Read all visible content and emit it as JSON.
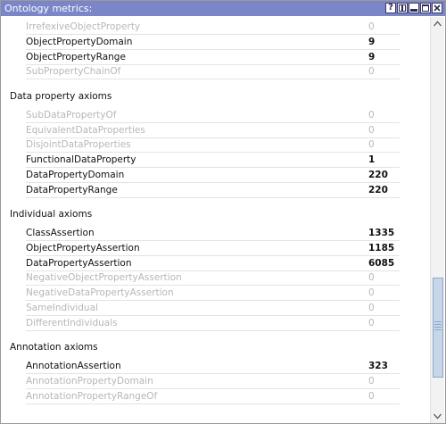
{
  "window": {
    "title": "Ontology metrics:"
  },
  "titlebar_buttons": [
    {
      "name": "help-button",
      "icon": "help-icon",
      "text": "?"
    },
    {
      "name": "split-button",
      "icon": "split-icon",
      "text": ""
    },
    {
      "name": "minimize-button",
      "icon": "minimize-icon",
      "text": ""
    },
    {
      "name": "maximize-button",
      "icon": "maximize-icon",
      "text": ""
    },
    {
      "name": "close-button",
      "icon": "close-icon",
      "text": ""
    }
  ],
  "sections": [
    {
      "title": "",
      "rows": [
        {
          "label": "IrrefexiveObjectProperty",
          "value": "0",
          "enabled": false
        },
        {
          "label": "ObjectPropertyDomain",
          "value": "9",
          "enabled": true
        },
        {
          "label": "ObjectPropertyRange",
          "value": "9",
          "enabled": true
        },
        {
          "label": "SubPropertyChainOf",
          "value": "0",
          "enabled": false
        }
      ]
    },
    {
      "title": "Data property axioms",
      "rows": [
        {
          "label": "SubDataPropertyOf",
          "value": "0",
          "enabled": false
        },
        {
          "label": "EquivalentDataProperties",
          "value": "0",
          "enabled": false
        },
        {
          "label": "DisjointDataProperties",
          "value": "0",
          "enabled": false
        },
        {
          "label": "FunctionalDataProperty",
          "value": "1",
          "enabled": true
        },
        {
          "label": "DataPropertyDomain",
          "value": "220",
          "enabled": true
        },
        {
          "label": "DataPropertyRange",
          "value": "220",
          "enabled": true
        }
      ]
    },
    {
      "title": "Individual axioms",
      "rows": [
        {
          "label": "ClassAssertion",
          "value": "1335",
          "enabled": true
        },
        {
          "label": "ObjectPropertyAssertion",
          "value": "1185",
          "enabled": true
        },
        {
          "label": "DataPropertyAssertion",
          "value": "6085",
          "enabled": true
        },
        {
          "label": "NegativeObjectPropertyAssertion",
          "value": "0",
          "enabled": false
        },
        {
          "label": "NegativeDataPropertyAssertion",
          "value": "0",
          "enabled": false
        },
        {
          "label": "SameIndividual",
          "value": "0",
          "enabled": false
        },
        {
          "label": "DifferentIndividuals",
          "value": "0",
          "enabled": false
        }
      ]
    },
    {
      "title": "Annotation axioms",
      "rows": [
        {
          "label": "AnnotationAssertion",
          "value": "323",
          "enabled": true
        },
        {
          "label": "AnnotationPropertyDomain",
          "value": "0",
          "enabled": false
        },
        {
          "label": "AnnotationPropertyRangeOf",
          "value": "0",
          "enabled": false
        }
      ]
    }
  ],
  "scrollbar": {
    "position": 0.88
  },
  "colors": {
    "titlebar": "#7b86c9",
    "disabled_text": "#b7b7b7"
  }
}
